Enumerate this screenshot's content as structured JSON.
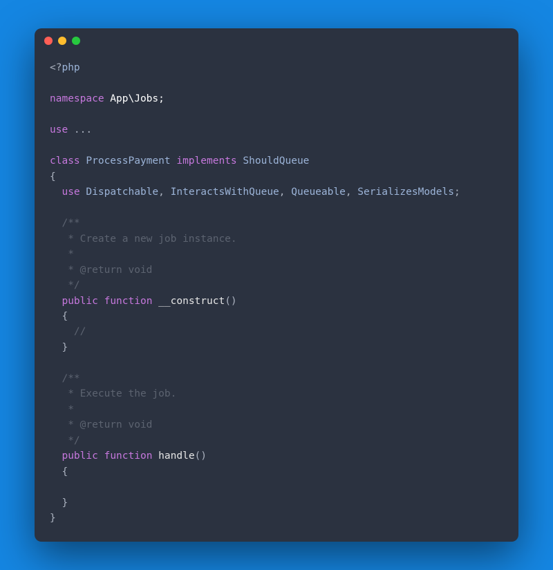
{
  "colors": {
    "bg": "#1586e2",
    "editor": "#2b3240",
    "dot_red": "#ff5f56",
    "dot_yellow": "#ffbd2e",
    "dot_green": "#27c93f",
    "keyword": "#c678dd",
    "class_token": "#9cb4d8",
    "function_name": "#e6e6e6",
    "comment": "#5c6370",
    "default": "#abb2bf"
  },
  "code": {
    "open_tag_lt_q": "<?",
    "open_tag_php": "php",
    "namespace_kw": "namespace",
    "namespace_val": " App\\Jobs;",
    "use_kw": "use",
    "use_ellipsis": " ...",
    "class_kw": "class",
    "class_name": " ProcessPayment ",
    "implements_kw": "implements",
    "implements_name": " ShouldQueue",
    "brace_open": "{",
    "brace_close": "}",
    "ind1": "  ",
    "ind2": "    ",
    "traits_use_kw": "use",
    "traits_sp": " ",
    "trait1": "Dispatchable",
    "trait2": "InteractsWithQueue",
    "trait3": "Queueable",
    "trait4": "SerializesModels",
    "comma": ", ",
    "semi": ";",
    "doc_open": "/**",
    "doc_star": " *",
    "doc_close": " */",
    "doc_create": " * Create a new job instance.",
    "doc_return": " * @return void",
    "doc_execute": " * Execute the job.",
    "public_kw": "public",
    "function_kw": "function",
    "fn_construct": " __construct",
    "fn_handle": " handle",
    "parens": "()",
    "slashslash": "//"
  }
}
